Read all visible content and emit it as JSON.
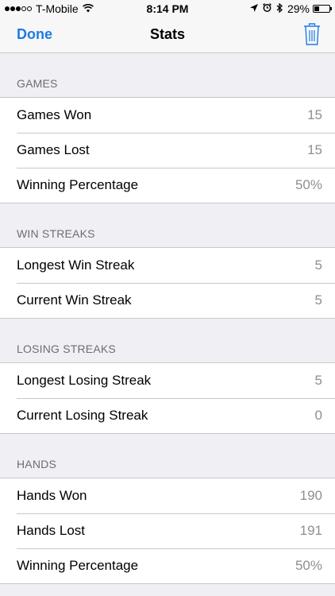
{
  "status_bar": {
    "carrier": "T-Mobile",
    "time": "8:14 PM",
    "battery": "29%",
    "signal_bars_filled": 3,
    "signal_bars_total": 5,
    "battery_level": 0.29
  },
  "nav": {
    "done_label": "Done",
    "title": "Stats",
    "trash_icon": "trash-icon",
    "accent_color": "#1e7ae3"
  },
  "sections": [
    {
      "header": "GAMES",
      "rows": [
        {
          "label": "Games Won",
          "value": "15"
        },
        {
          "label": "Games Lost",
          "value": "15"
        },
        {
          "label": "Winning Percentage",
          "value": "50%"
        }
      ]
    },
    {
      "header": "WIN STREAKS",
      "rows": [
        {
          "label": "Longest Win Streak",
          "value": "5"
        },
        {
          "label": "Current Win Streak",
          "value": "5"
        }
      ]
    },
    {
      "header": "LOSING STREAKS",
      "rows": [
        {
          "label": "Longest Losing Streak",
          "value": "5"
        },
        {
          "label": "Current Losing Streak",
          "value": "0"
        }
      ]
    },
    {
      "header": "HANDS",
      "rows": [
        {
          "label": "Hands Won",
          "value": "190"
        },
        {
          "label": "Hands Lost",
          "value": "191"
        },
        {
          "label": "Winning Percentage",
          "value": "50%"
        }
      ]
    }
  ]
}
